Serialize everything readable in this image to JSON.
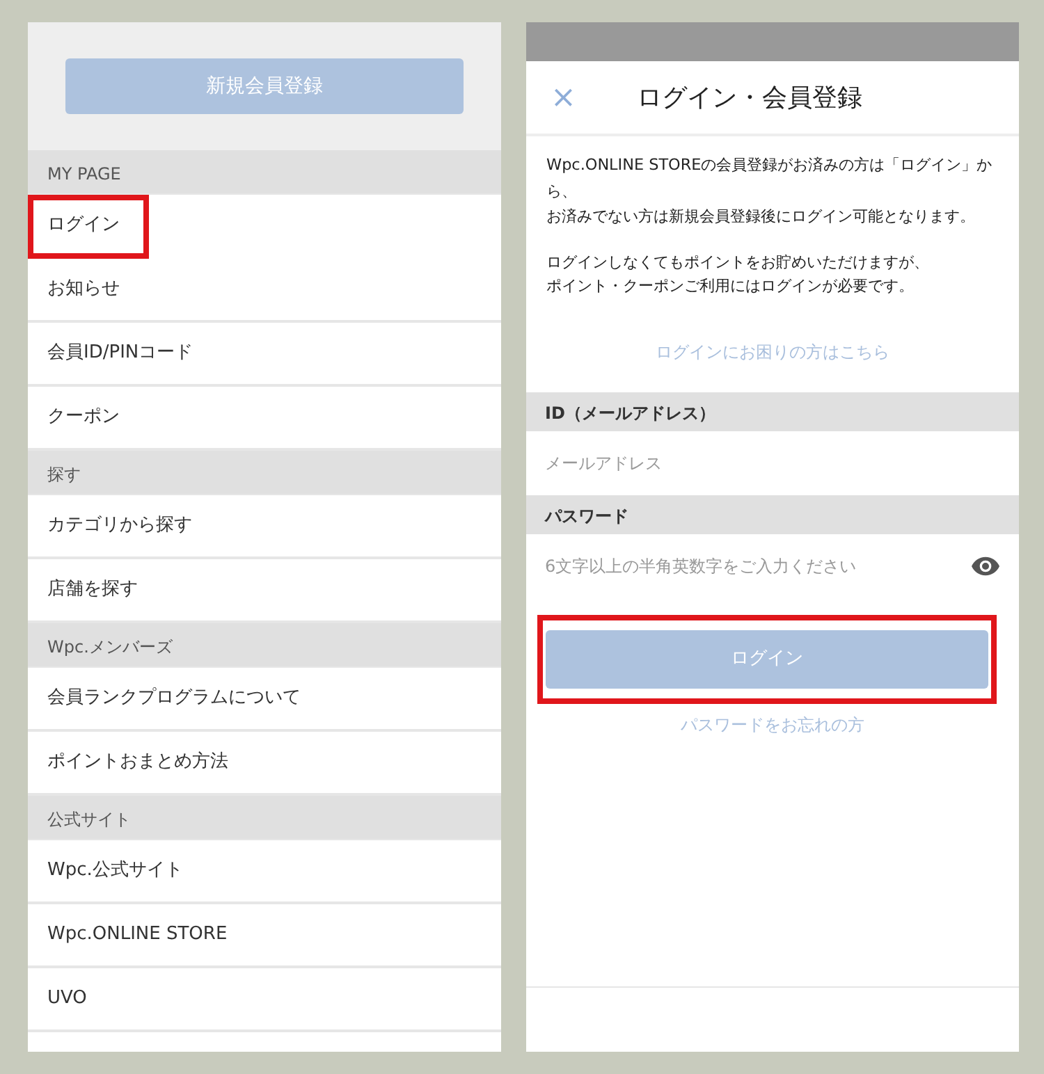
{
  "menu": {
    "register_button": "新規会員登録",
    "sections": [
      {
        "heading": "MY PAGE",
        "items": [
          {
            "label": "ログイン",
            "highlighted": true
          },
          {
            "label": "お知らせ",
            "highlighted": false
          },
          {
            "label": "会員ID/PINコード",
            "highlighted": false
          },
          {
            "label": "クーポン",
            "highlighted": false
          }
        ]
      },
      {
        "heading": "探す",
        "items": [
          {
            "label": "カテゴリから探す",
            "highlighted": false
          },
          {
            "label": "店舗を探す",
            "highlighted": false
          }
        ]
      },
      {
        "heading": "Wpc.メンバーズ",
        "items": [
          {
            "label": "会員ランクプログラムについて",
            "highlighted": false
          },
          {
            "label": "ポイントおまとめ方法",
            "highlighted": false
          }
        ]
      },
      {
        "heading": "公式サイト",
        "items": [
          {
            "label": "Wpc.公式サイト",
            "highlighted": false
          },
          {
            "label": "Wpc.ONLINE STORE",
            "highlighted": false
          },
          {
            "label": "UVO",
            "highlighted": false
          }
        ]
      }
    ]
  },
  "login": {
    "close": "×",
    "title": "ログイン・会員登録",
    "paragraphs": [
      [
        "Wpc.ONLINE STOREの会員登録がお済みの方は「ログイン」から、",
        "お済みでない方は新規会員登録後にログイン可能となります。"
      ],
      [
        "ログインしなくてもポイントをお貯めいただけますが、",
        "ポイント・クーポンご利用にはログインが必要です。"
      ]
    ],
    "help_link": "ログインにお困りの方はこちら",
    "fields": [
      {
        "label": "ID（メールアドレス）",
        "placeholder": "メールアドレス",
        "kind": "email"
      },
      {
        "label": "パスワード",
        "placeholder": "6文字以上の半角英数字をご入力ください",
        "kind": "password"
      }
    ],
    "login_button": {
      "label": "ログイン",
      "highlighted": true
    },
    "forgot_link": "パスワードをお忘れの方"
  }
}
